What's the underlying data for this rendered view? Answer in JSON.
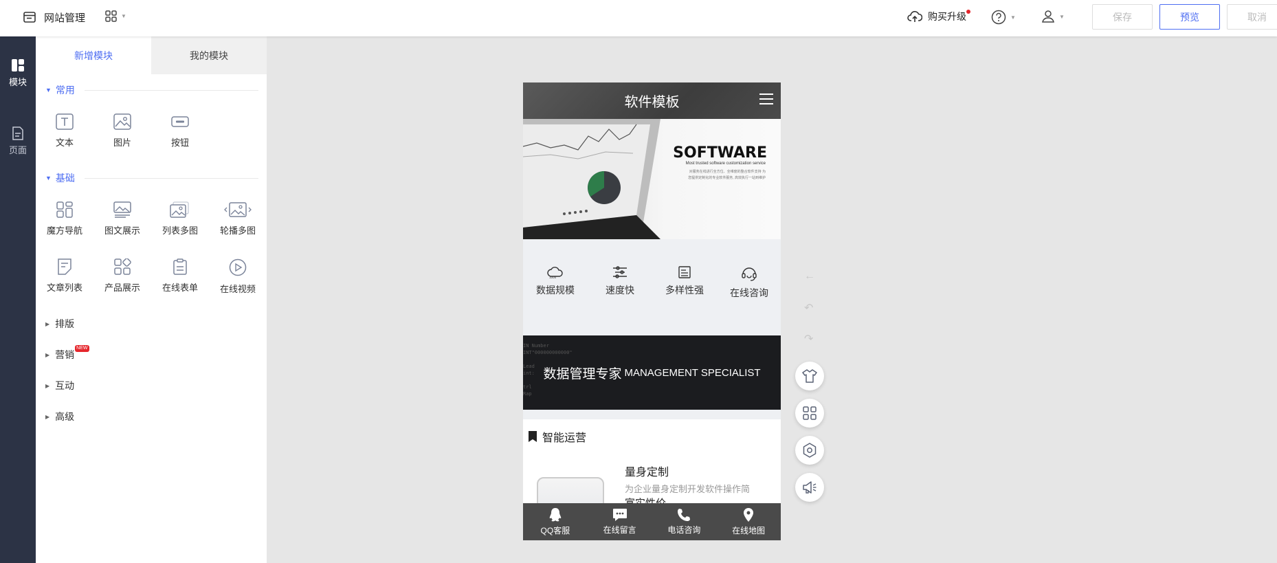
{
  "topbar": {
    "site_title": "网站管理",
    "upgrade_label": "购买升级",
    "save_label": "保存",
    "preview_label": "预览",
    "cancel_label": "取消"
  },
  "rail": {
    "items": [
      {
        "label": "模块",
        "icon": "layout-icon",
        "active": true
      },
      {
        "label": "页面",
        "icon": "page-icon",
        "active": false
      }
    ]
  },
  "panel": {
    "tabs": [
      {
        "label": "新增模块",
        "active": true
      },
      {
        "label": "我的模块",
        "active": false
      }
    ],
    "sections": {
      "common": {
        "title": "常用",
        "items": [
          {
            "label": "文本",
            "icon": "text-icon"
          },
          {
            "label": "图片",
            "icon": "image-icon"
          },
          {
            "label": "按钮",
            "icon": "button-icon"
          }
        ]
      },
      "basic": {
        "title": "基础",
        "items": [
          {
            "label": "魔方导航",
            "icon": "cube-nav-icon"
          },
          {
            "label": "图文展示",
            "icon": "image-text-icon"
          },
          {
            "label": "列表多图",
            "icon": "list-images-icon"
          },
          {
            "label": "轮播多图",
            "icon": "carousel-icon"
          },
          {
            "label": "文章列表",
            "icon": "article-list-icon"
          },
          {
            "label": "产品展示",
            "icon": "product-icon"
          },
          {
            "label": "在线表单",
            "icon": "form-icon"
          },
          {
            "label": "在线视频",
            "icon": "video-icon"
          }
        ]
      },
      "collapsed": [
        {
          "label": "排版",
          "badge": ""
        },
        {
          "label": "营销",
          "badge": "NEW"
        },
        {
          "label": "互动",
          "badge": ""
        },
        {
          "label": "高级",
          "badge": ""
        }
      ]
    }
  },
  "phone": {
    "header_title": "软件模板",
    "banner": {
      "title": "SOFTWARE",
      "subtitle": "Most trusted software customization service",
      "desc": "对服务在线进行全方位、全维度的整合软件支持 为您提供定制化的专业软件服务, 高效执行一站到维护"
    },
    "features": [
      {
        "label": "数据规模",
        "icon": "cloud-data-icon"
      },
      {
        "label": "速度快",
        "icon": "speed-icon"
      },
      {
        "label": "多样性强",
        "icon": "variety-icon"
      },
      {
        "label": "在线咨询",
        "icon": "headset-icon"
      }
    ],
    "strip": {
      "cn": "数据管理专家",
      "en": "MANAGEMENT SPECIALIST"
    },
    "section": {
      "title": "智能运营",
      "item_title": "量身定制",
      "item_desc": "为企业量身定制开发软件操作简",
      "item_more": "富实性价"
    },
    "footer": [
      {
        "label": "QQ客服",
        "icon": "qq-icon"
      },
      {
        "label": "在线留言",
        "icon": "message-icon"
      },
      {
        "label": "电话咨询",
        "icon": "phone-icon"
      },
      {
        "label": "在线地图",
        "icon": "map-pin-icon"
      }
    ]
  },
  "side_tools": [
    {
      "icon": "back-arrow-icon"
    },
    {
      "icon": "undo-icon"
    },
    {
      "icon": "redo-icon"
    },
    {
      "icon": "theme-shirt-icon"
    },
    {
      "icon": "modules-grid-icon"
    },
    {
      "icon": "settings-icon"
    },
    {
      "icon": "announce-icon"
    }
  ],
  "colors": {
    "accent": "#4e6ef2",
    "rail": "#2c3345",
    "badge": "#e5262c"
  }
}
